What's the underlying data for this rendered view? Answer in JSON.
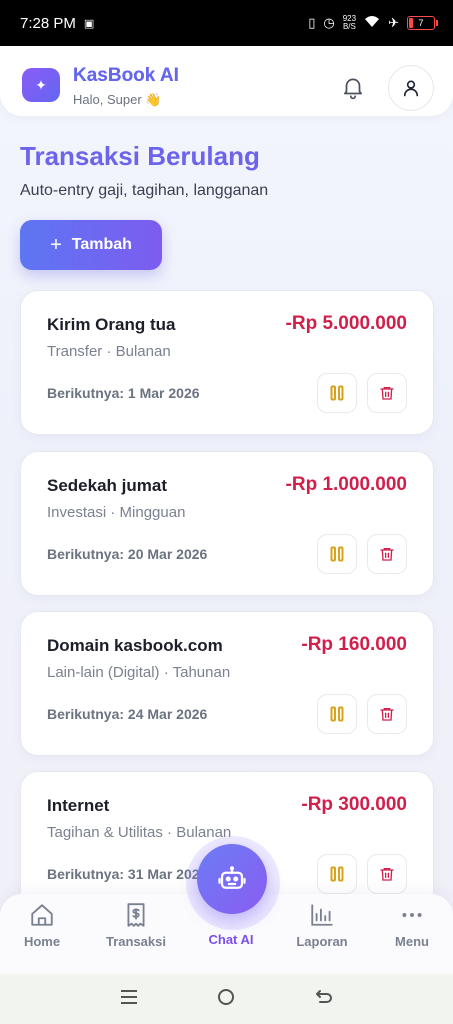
{
  "status_bar": {
    "time": "7:28 PM",
    "net_speed_top": "923",
    "net_speed_bottom": "B/S",
    "battery_level": "7",
    "battery_color": "#ff4a4a"
  },
  "header": {
    "app_name": "KasBook AI",
    "greeting": "Halo, Super 👋",
    "logo_icon": "wallet-sparkle-icon",
    "notification_icon": "bell-icon",
    "profile_icon": "user-icon"
  },
  "page": {
    "title": "Transaksi Berulang",
    "subtitle": "Auto-entry gaji, tagihan, langganan",
    "add_label": "Tambah",
    "add_icon": "plus-icon"
  },
  "transactions": [
    {
      "name": "Kirim Orang tua",
      "amount": "-Rp 5.000.000",
      "meta": "Transfer · Bulanan",
      "next": "Berikutnya: 1 Mar 2026"
    },
    {
      "name": "Sedekah jumat",
      "amount": "-Rp 1.000.000",
      "meta": "Investasi · Mingguan",
      "next": "Berikutnya: 20 Mar 2026"
    },
    {
      "name": "Domain kasbook.com",
      "amount": "-Rp 160.000",
      "meta": "Lain-lain (Digital) · Tahunan",
      "next": "Berikutnya: 24 Mar 2026"
    },
    {
      "name": "Internet",
      "amount": "-Rp 300.000",
      "meta": "Tagihan & Utilitas · Bulanan",
      "next": "Berikutnya: 31 Mar 2026"
    }
  ],
  "nav": {
    "home": "Home",
    "transaksi": "Transaksi",
    "chat": "Chat AI",
    "laporan": "Laporan",
    "menu": "Menu"
  },
  "colors": {
    "accent": "#6d63ec",
    "expense": "#d11f4b",
    "pause": "#d9a21b",
    "delete": "#d11f4b",
    "active_nav": "#7c4df0"
  }
}
